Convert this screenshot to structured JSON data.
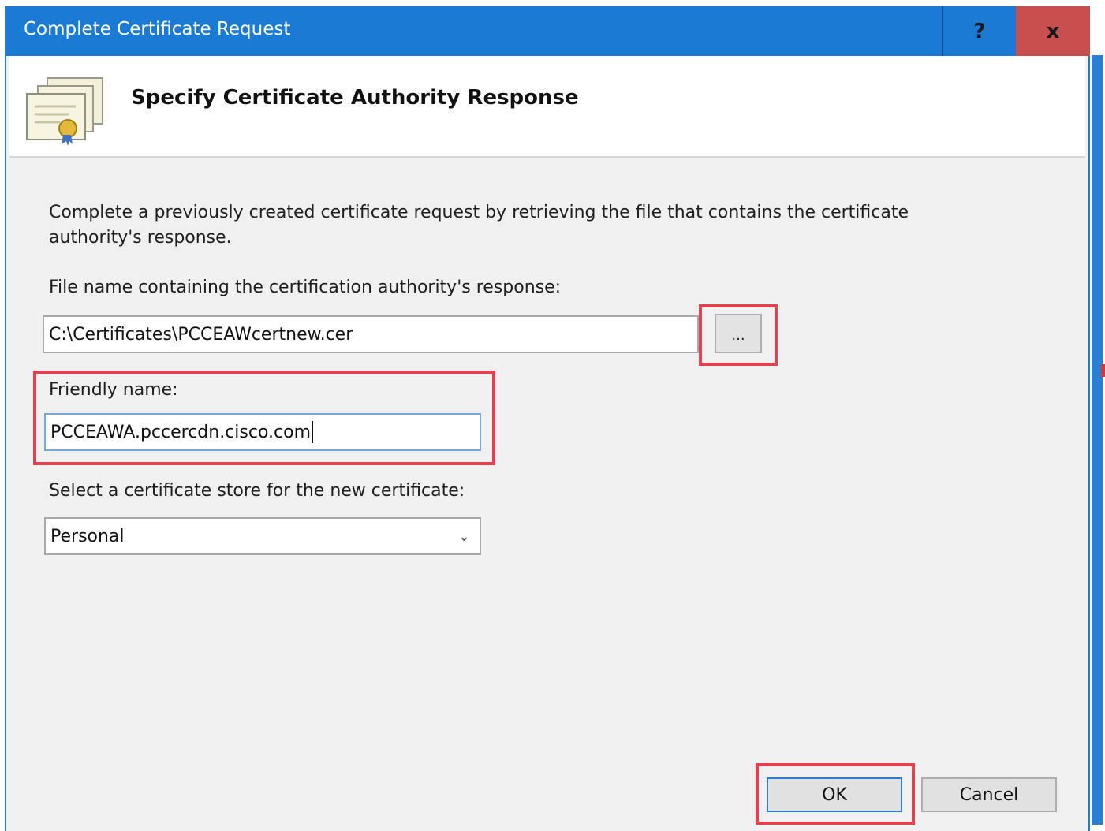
{
  "window": {
    "title": "Complete Certificate Request",
    "help_label": "?",
    "close_label": "x"
  },
  "header": {
    "title": "Specify Certificate Authority Response",
    "icon": "certificate-icon"
  },
  "form": {
    "description": "Complete a previously created certificate request by retrieving the file that contains the certificate authority's response.",
    "file_label": "File name containing the certification authority's response:",
    "file_value": "C:\\Certificates\\PCCEAWcertnew.cer",
    "browse_label": "...",
    "friendly_label": "Friendly name:",
    "friendly_value": "PCCEAWA.pccercdn.cisco.com",
    "store_label": "Select a certificate store for the new certificate:",
    "store_value": "Personal"
  },
  "buttons": {
    "ok": "OK",
    "cancel": "Cancel"
  },
  "colors": {
    "titlebar": "#1b7ad3",
    "close": "#c94f4f",
    "highlight": "#e0434f"
  }
}
